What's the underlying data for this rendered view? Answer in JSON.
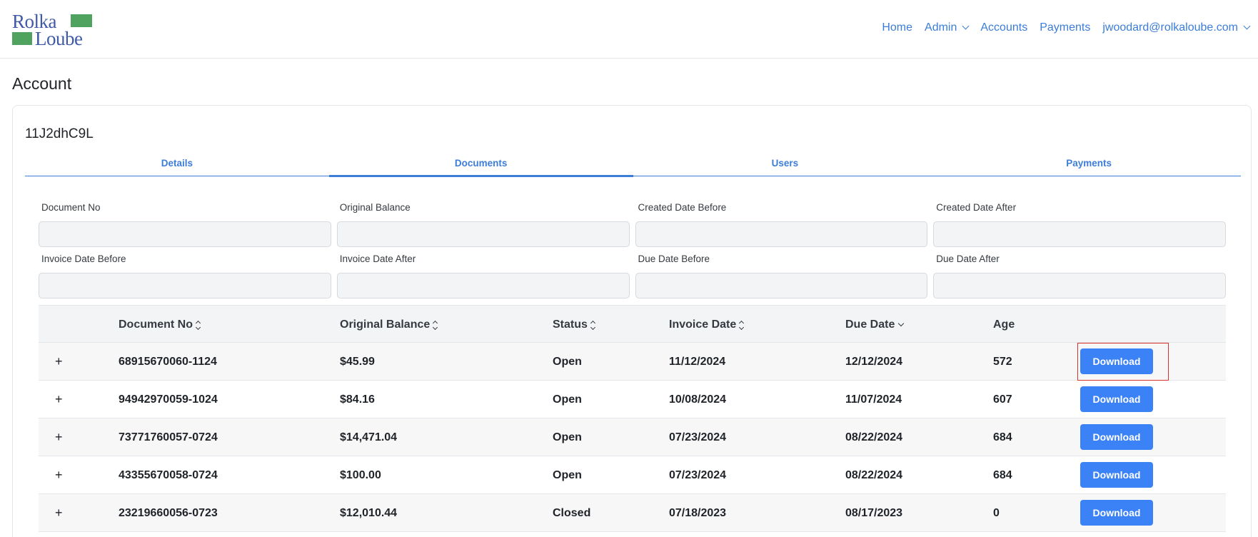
{
  "header": {
    "logo": {
      "line1": "Rolka",
      "line2": "Loube",
      "brand_green": "#4fa35e",
      "brand_blue": "#3f5aa6"
    },
    "nav": [
      {
        "label": "Home",
        "dropdown": false
      },
      {
        "label": "Admin",
        "dropdown": true
      },
      {
        "label": "Accounts",
        "dropdown": false
      },
      {
        "label": "Payments",
        "dropdown": false
      },
      {
        "label": "jwoodard@rolkaloube.com",
        "dropdown": true
      }
    ]
  },
  "page": {
    "title": "Account"
  },
  "account": {
    "id": "11J2dhC9L",
    "tabs": [
      {
        "label": "Details",
        "active": false
      },
      {
        "label": "Documents",
        "active": true
      },
      {
        "label": "Users",
        "active": false
      },
      {
        "label": "Payments",
        "active": false
      }
    ]
  },
  "filters": [
    {
      "label": "Document No",
      "value": ""
    },
    {
      "label": "Original Balance",
      "value": ""
    },
    {
      "label": "Created Date Before",
      "value": ""
    },
    {
      "label": "Created Date After",
      "value": ""
    },
    {
      "label": "Invoice Date Before",
      "value": ""
    },
    {
      "label": "Invoice Date After",
      "value": ""
    },
    {
      "label": "Due Date Before",
      "value": ""
    },
    {
      "label": "Due Date After",
      "value": ""
    }
  ],
  "table": {
    "columns": [
      {
        "label": "Document No",
        "sort": "both"
      },
      {
        "label": "Original Balance",
        "sort": "both"
      },
      {
        "label": "Status",
        "sort": "both"
      },
      {
        "label": "Invoice Date",
        "sort": "both"
      },
      {
        "label": "Due Date",
        "sort": "desc"
      },
      {
        "label": "Age",
        "sort": "none"
      }
    ],
    "expand_symbol": "+",
    "download_label": "Download",
    "rows": [
      {
        "document_no": "68915670060-1124",
        "original_balance": "$45.99",
        "status": "Open",
        "invoice_date": "11/12/2024",
        "due_date": "12/12/2024",
        "age": "572"
      },
      {
        "document_no": "94942970059-1024",
        "original_balance": "$84.16",
        "status": "Open",
        "invoice_date": "10/08/2024",
        "due_date": "11/07/2024",
        "age": "607"
      },
      {
        "document_no": "73771760057-0724",
        "original_balance": "$14,471.04",
        "status": "Open",
        "invoice_date": "07/23/2024",
        "due_date": "08/22/2024",
        "age": "684"
      },
      {
        "document_no": "43355670058-0724",
        "original_balance": "$100.00",
        "status": "Open",
        "invoice_date": "07/23/2024",
        "due_date": "08/22/2024",
        "age": "684"
      },
      {
        "document_no": "23219660056-0723",
        "original_balance": "$12,010.44",
        "status": "Closed",
        "invoice_date": "07/18/2023",
        "due_date": "08/17/2023",
        "age": "0"
      }
    ]
  },
  "accent_color": "#3b7dd8",
  "button_color": "#3b82f6",
  "highlight_color": "#d9312b"
}
